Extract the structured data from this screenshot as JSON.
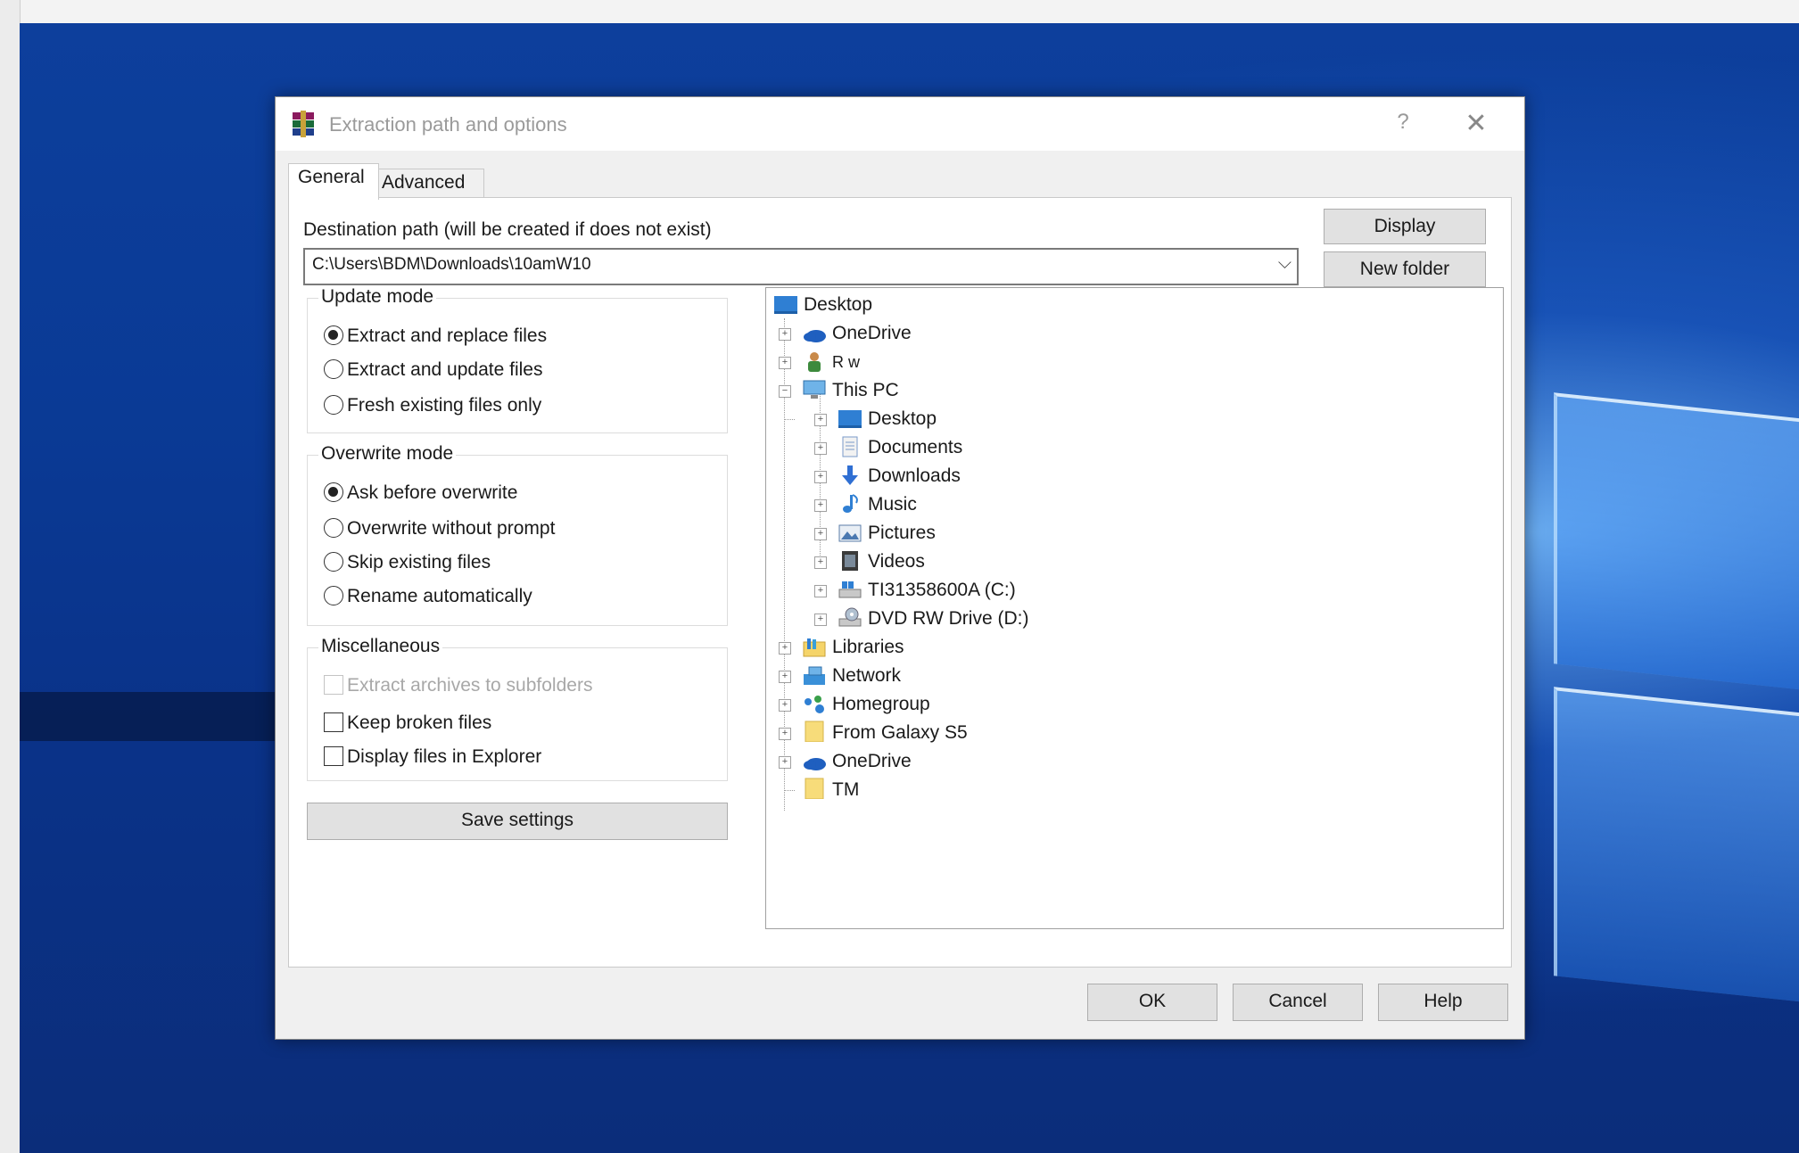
{
  "window": {
    "title": "Extraction path and options",
    "help_glyph": "?",
    "close_glyph": "✕"
  },
  "tabs": [
    {
      "label": "General",
      "active": true
    },
    {
      "label": "Advanced",
      "active": false
    }
  ],
  "destination": {
    "label": "Destination path (will be created if does not exist)",
    "value": "C:\\Users\\BDM\\Downloads\\10amW10",
    "arrow": "⌵"
  },
  "buttons": {
    "display": "Display",
    "new_folder": "New folder",
    "save_settings": "Save settings",
    "ok": "OK",
    "cancel": "Cancel",
    "help": "Help"
  },
  "update_mode": {
    "title": "Update mode",
    "options": [
      {
        "label": "Extract and replace files",
        "selected": true
      },
      {
        "label": "Extract and update files",
        "selected": false
      },
      {
        "label": "Fresh existing files only",
        "selected": false
      }
    ]
  },
  "overwrite_mode": {
    "title": "Overwrite mode",
    "options": [
      {
        "label": "Ask before overwrite",
        "selected": true
      },
      {
        "label": "Overwrite without prompt",
        "selected": false
      },
      {
        "label": "Skip existing files",
        "selected": false
      },
      {
        "label": "Rename automatically",
        "selected": false
      }
    ]
  },
  "miscellaneous": {
    "title": "Miscellaneous",
    "options": [
      {
        "label": "Extract archives to subfolders",
        "checked": false,
        "disabled": true
      },
      {
        "label": "Keep broken files",
        "checked": false,
        "disabled": false
      },
      {
        "label": "Display files in Explorer",
        "checked": false,
        "disabled": false
      }
    ]
  },
  "tree": {
    "root": {
      "label": "Desktop",
      "icon": "desktop-icon"
    },
    "items": [
      {
        "label": "OneDrive",
        "icon": "onedrive-icon",
        "level": 1
      },
      {
        "label": "R w",
        "icon": "user-icon",
        "level": 1
      },
      {
        "label": "This PC",
        "icon": "computer-icon",
        "level": 1,
        "expanded": true
      },
      {
        "label": "Desktop",
        "icon": "desktop-icon",
        "level": 2
      },
      {
        "label": "Documents",
        "icon": "documents-icon",
        "level": 2
      },
      {
        "label": "Downloads",
        "icon": "downloads-icon",
        "level": 2
      },
      {
        "label": "Music",
        "icon": "music-icon",
        "level": 2
      },
      {
        "label": "Pictures",
        "icon": "pictures-icon",
        "level": 2
      },
      {
        "label": "Videos",
        "icon": "videos-icon",
        "level": 2
      },
      {
        "label": "TI31358600A (C:)",
        "icon": "drive-icon",
        "level": 2
      },
      {
        "label": "DVD RW Drive (D:)",
        "icon": "dvd-drive-icon",
        "level": 2
      },
      {
        "label": "Libraries",
        "icon": "libraries-icon",
        "level": 1
      },
      {
        "label": "Network",
        "icon": "network-icon",
        "level": 1
      },
      {
        "label": "Homegroup",
        "icon": "homegroup-icon",
        "level": 1
      },
      {
        "label": "From Galaxy S5",
        "icon": "folder-icon",
        "level": 1
      },
      {
        "label": "OneDrive",
        "icon": "onedrive-icon",
        "level": 1
      },
      {
        "label": "TM",
        "icon": "folder-icon",
        "level": 1,
        "leaf": true
      }
    ]
  },
  "colors": {
    "desktop_blue": "#0a3a95",
    "dialog_bg": "#f0f0f0",
    "button_bg": "#e1e1e1",
    "folder_yellow": "#f5d46a",
    "desktop_icon_blue": "#2f7fd3"
  }
}
